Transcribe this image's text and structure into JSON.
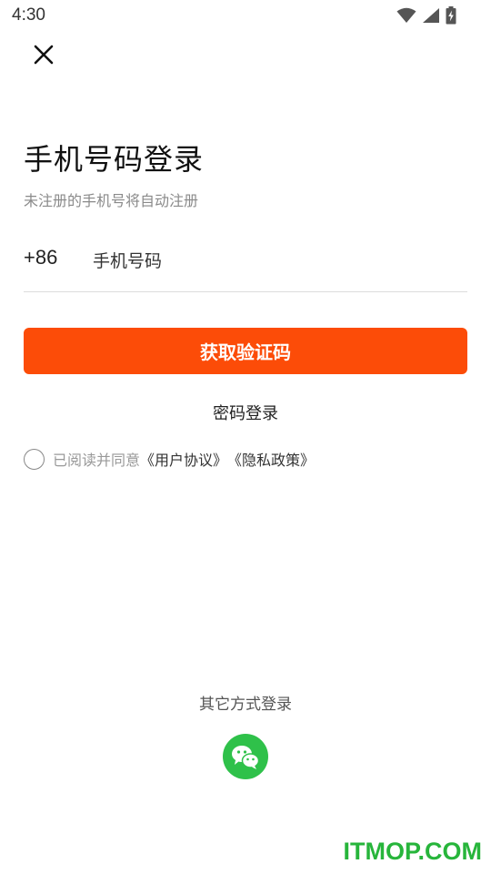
{
  "status_bar": {
    "time": "4:30",
    "icons": [
      "wifi-icon",
      "cellular-signal-icon",
      "battery-charging-icon"
    ]
  },
  "close_icon": "close-icon",
  "title": "手机号码登录",
  "subtitle": "未注册的手机号将自动注册",
  "phone": {
    "country_code": "+86",
    "placeholder": "手机号码",
    "value": ""
  },
  "primary_button": {
    "label": "获取验证码",
    "color": "#fc4c08"
  },
  "password_login": "密码登录",
  "agreement": {
    "checked": false,
    "prefix": "已阅读并同意",
    "user_agreement": "《用户协议》",
    "privacy_policy": "《隐私政策》"
  },
  "other_login": {
    "label": "其它方式登录",
    "wechat_icon": "wechat-icon",
    "wechat_color": "#2fc14a"
  },
  "watermark": "ITMOP.COM"
}
